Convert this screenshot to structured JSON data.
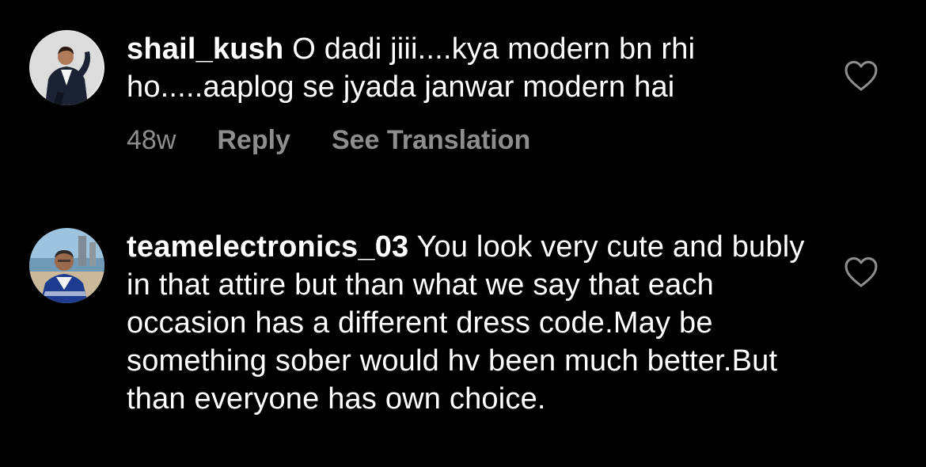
{
  "theme": {
    "background": "#000000",
    "text": "#ffffff",
    "muted": "#8e8e8e"
  },
  "comments": [
    {
      "username": "shail_kush",
      "text": "O dadi jiii....kya modern bn rhi ho.....aaplog se jyada janwar modern hai",
      "time": "48w",
      "reply_label": "Reply",
      "translate_label": "See Translation",
      "avatar_icon": "user-avatar",
      "like_icon": "heart-outline-icon"
    },
    {
      "username": "teamelectronics_03",
      "text": "You  look very cute and bubly in that attire but than what we say that each occasion has a different dress code.May be something sober would hv been much better.But than everyone has own choice.",
      "avatar_icon": "user-avatar",
      "like_icon": "heart-outline-icon"
    }
  ]
}
